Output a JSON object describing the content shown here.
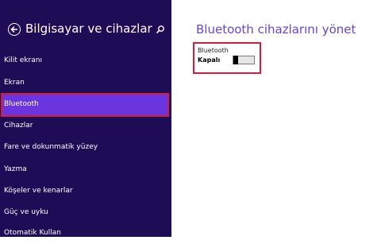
{
  "sidebar": {
    "title": "Bilgisayar ve cihazlar",
    "items": [
      {
        "label": "Kilit ekranı"
      },
      {
        "label": "Ekran"
      },
      {
        "label": "Bluetooth"
      },
      {
        "label": "Cihazlar"
      },
      {
        "label": "Fare ve dokunmatik yüzey"
      },
      {
        "label": "Yazma"
      },
      {
        "label": "Köşeler ve kenarlar"
      },
      {
        "label": "Güç ve uyku"
      },
      {
        "label": "Otomatik Kullan"
      }
    ],
    "selected_item": "Bluetooth"
  },
  "main": {
    "title": "Bluetooth cihazlarını yönet",
    "bluetooth_label": "Bluetooth",
    "bluetooth_state": "Kapalı",
    "toggle_on": false
  },
  "icons": {
    "back": "back-arrow-icon",
    "search": "search-icon"
  },
  "colors": {
    "sidebar_bg": "#1e0c56",
    "selected_bg": "#6a35df",
    "highlight_border": "#d21e3c",
    "title_color": "#6b45c9"
  }
}
